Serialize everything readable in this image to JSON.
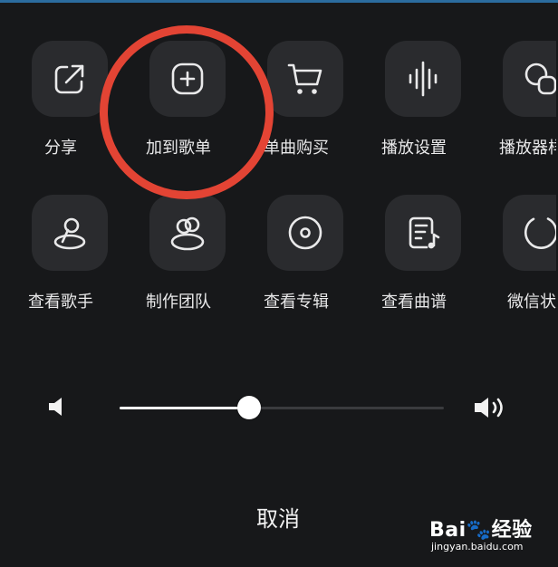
{
  "share_row_1": [
    {
      "label": "分享",
      "icon": "share-icon"
    },
    {
      "label": "加到歌单",
      "icon": "add-to-playlist-icon"
    },
    {
      "label": "单曲购买",
      "icon": "cart-icon"
    },
    {
      "label": "播放设置",
      "icon": "waveform-icon"
    },
    {
      "label": "播放器样",
      "icon": "player-style-icon"
    }
  ],
  "share_row_2": [
    {
      "label": "查看歌手",
      "icon": "singer-icon"
    },
    {
      "label": "制作团队",
      "icon": "team-icon"
    },
    {
      "label": "查看专辑",
      "icon": "album-disc-icon"
    },
    {
      "label": "查看曲谱",
      "icon": "sheet-music-icon"
    },
    {
      "label": "微信状",
      "icon": "wechat-status-icon"
    }
  ],
  "volume": {
    "level": 0.4,
    "low_icon": "volume-low-icon",
    "high_icon": "volume-high-icon"
  },
  "cancel_label": "取消",
  "watermark": {
    "logo_text_left": "Bai",
    "logo_text_right": "经验",
    "url": "jingyan.baidu.com"
  },
  "colors": {
    "background": "#17181a",
    "tile": "#2a2b2e",
    "annotation": "#e34434",
    "topbar": "#2b6c9f"
  }
}
